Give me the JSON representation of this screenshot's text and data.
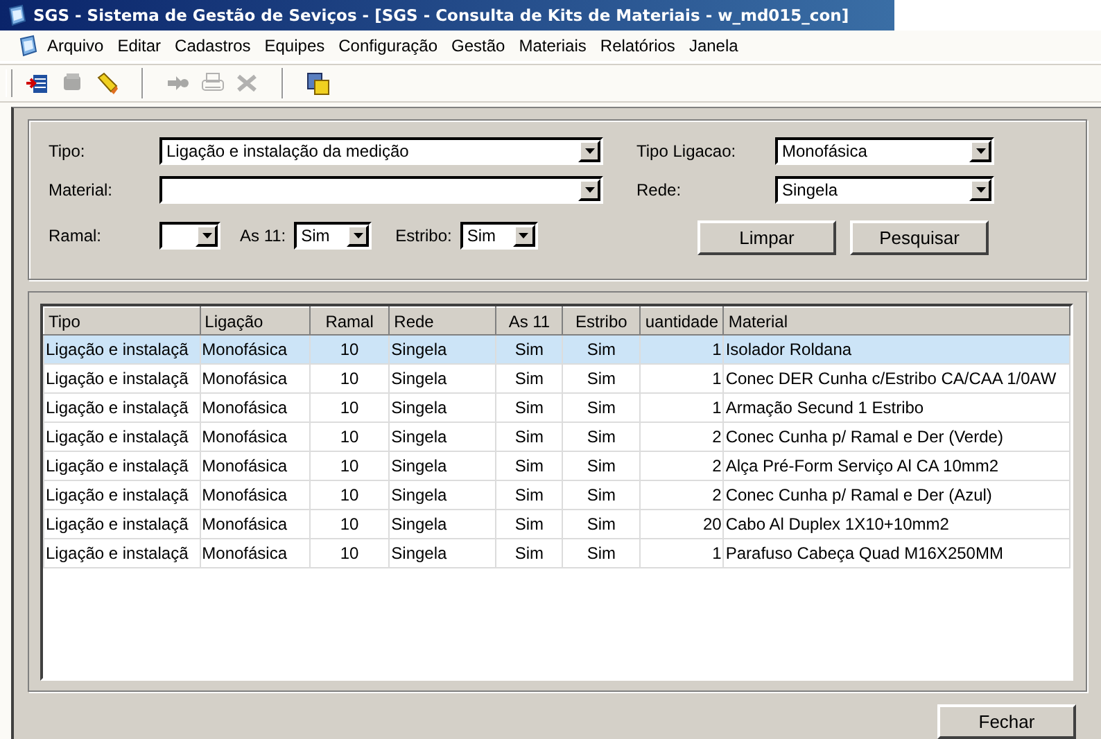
{
  "window": {
    "title": "SGS - Sistema de Gestão de Seviços - [SGS - Consulta de Kits de Materiais - w_md015_con]"
  },
  "menu": [
    "Arquivo",
    "Editar",
    "Cadastros",
    "Equipes",
    "Configuração",
    "Gestão",
    "Materiais",
    "Relatórios",
    "Janela"
  ],
  "toolbar": [
    {
      "kind": "insert",
      "disabled": false
    },
    {
      "kind": "stack",
      "disabled": true
    },
    {
      "kind": "eraser",
      "disabled": false
    },
    {
      "kind": "sep"
    },
    {
      "kind": "arrow",
      "disabled": true
    },
    {
      "kind": "printer",
      "disabled": true
    },
    {
      "kind": "cross",
      "disabled": true
    },
    {
      "kind": "sep"
    },
    {
      "kind": "help",
      "disabled": false
    }
  ],
  "filters": {
    "tipo": {
      "label": "Tipo:",
      "value": "Ligação e instalação da medição"
    },
    "material": {
      "label": "Material:"
    },
    "ramal": {
      "label": "Ramal:"
    },
    "as11": {
      "label": "As 11:",
      "value": "Sim"
    },
    "estribo": {
      "label": "Estribo:",
      "value": "Sim"
    },
    "tipo_ligacao": {
      "label": "Tipo Ligacao:",
      "value": "Monofásica"
    },
    "rede": {
      "label": "Rede:",
      "value": "Singela"
    }
  },
  "buttons": [
    "Limpar",
    "Pesquisar"
  ],
  "table": {
    "columns": [
      {
        "label": "Tipo"
      },
      {
        "label": "Ligação"
      },
      {
        "label": "Ramal"
      },
      {
        "label": "Rede"
      },
      {
        "label": "As 11"
      },
      {
        "label": "Estribo"
      },
      {
        "label": "uantidade"
      },
      {
        "label": "Material"
      }
    ],
    "rows": [
      {
        "selected": true,
        "cells": [
          "Ligação e instalaçã",
          "Monofásica",
          "10",
          "Singela",
          "Sim",
          "Sim",
          "1",
          "Isolador Roldana"
        ]
      },
      {
        "selected": false,
        "cells": [
          "Ligação e instalaçã",
          "Monofásica",
          "10",
          "Singela",
          "Sim",
          "Sim",
          "1",
          "Conec DER Cunha c/Estribo CA/CAA 1/0AW"
        ]
      },
      {
        "selected": false,
        "cells": [
          "Ligação e instalaçã",
          "Monofásica",
          "10",
          "Singela",
          "Sim",
          "Sim",
          "1",
          "Armação Secund 1 Estribo"
        ]
      },
      {
        "selected": false,
        "cells": [
          "Ligação e instalaçã",
          "Monofásica",
          "10",
          "Singela",
          "Sim",
          "Sim",
          "2",
          "Conec Cunha p/ Ramal e Der (Verde)"
        ]
      },
      {
        "selected": false,
        "cells": [
          "Ligação e instalaçã",
          "Monofásica",
          "10",
          "Singela",
          "Sim",
          "Sim",
          "2",
          "Alça Pré-Form Serviço Al CA 10mm2"
        ]
      },
      {
        "selected": false,
        "cells": [
          "Ligação e instalaçã",
          "Monofásica",
          "10",
          "Singela",
          "Sim",
          "Sim",
          "2",
          "Conec Cunha p/ Ramal e Der (Azul)"
        ]
      },
      {
        "selected": false,
        "cells": [
          "Ligação e instalaçã",
          "Monofásica",
          "10",
          "Singela",
          "Sim",
          "Sim",
          "20",
          "Cabo Al Duplex 1X10+10mm2"
        ]
      },
      {
        "selected": false,
        "cells": [
          "Ligação e instalaçã",
          "Monofásica",
          "10",
          "Singela",
          "Sim",
          "Sim",
          "1",
          "Parafuso Cabeça Quad M16X250MM"
        ]
      }
    ]
  },
  "close_button": "Fechar"
}
